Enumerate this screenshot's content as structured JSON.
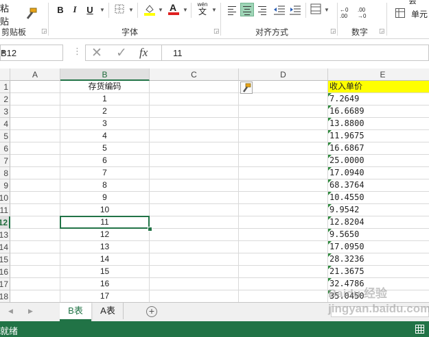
{
  "ribbon": {
    "clipboard": {
      "paste_label": "粘贴",
      "group_label": "剪贴板"
    },
    "font": {
      "group_label": "字体",
      "bold": "B",
      "italic": "I",
      "underline": "U",
      "fill_color": "#FFFF00",
      "font_color": "#E02020",
      "phonetic_top": "wén",
      "phonetic_bottom": "文"
    },
    "alignment": {
      "group_label": "对齐方式"
    },
    "number": {
      "group_label": "数字",
      "inc_decimal": "←0\n.00",
      "dec_decimal": ".00\n→0"
    },
    "styles": {
      "cell_label": "单元",
      "row1": "会"
    }
  },
  "formula_bar": {
    "name_box": "B12",
    "value": "11",
    "fx": "fx"
  },
  "grid": {
    "columns": [
      "A",
      "B",
      "C",
      "D",
      "E"
    ],
    "selected_column": "B",
    "row_numbers": [
      "1",
      "2",
      "3",
      "4",
      "5",
      "6",
      "7",
      "8",
      "9",
      "10",
      "11",
      "12",
      "13",
      "14",
      "15",
      "16",
      "17",
      "18"
    ],
    "selected_row": "12",
    "b_header": "存货编码",
    "e_header": "收入单价",
    "header_highlight": "#FFFF00",
    "b_values": [
      "1",
      "2",
      "3",
      "4",
      "5",
      "6",
      "7",
      "8",
      "9",
      "10",
      "11",
      "12",
      "13",
      "14",
      "15",
      "16",
      "17"
    ],
    "e_values": [
      "7.2649",
      "16.6689",
      "13.8800",
      "11.9675",
      "16.6867",
      "25.0000",
      "17.0940",
      "68.3764",
      "10.4550",
      "9.9542",
      "12.8204",
      "9.5650",
      "17.0950",
      "28.3236",
      "21.3675",
      "32.4786",
      "35.0450"
    ]
  },
  "sheet_tabs": [
    {
      "label": "B表",
      "active": true
    },
    {
      "label": "A表",
      "active": false
    }
  ],
  "status": {
    "text": "就绪"
  },
  "watermark": "Baidu 经验\njingyan.baidu.com",
  "colors": {
    "excel_green": "#217346"
  }
}
